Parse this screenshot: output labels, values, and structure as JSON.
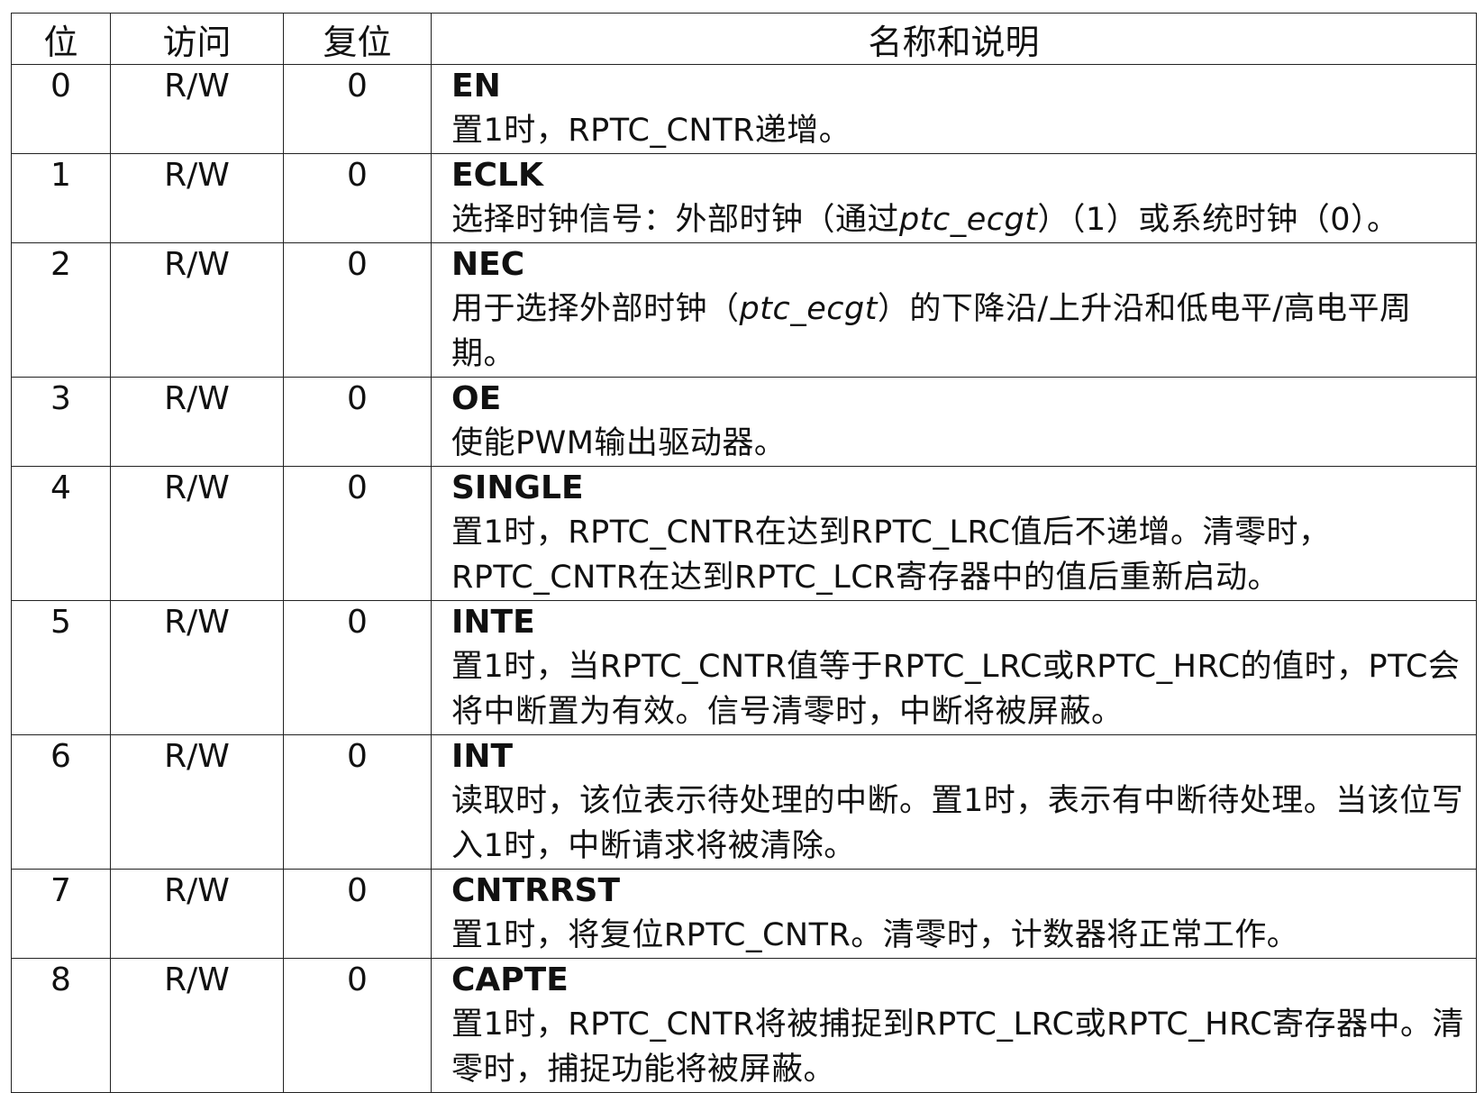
{
  "headers": {
    "bit": "位",
    "access": "访问",
    "reset": "复位",
    "description": "名称和说明"
  },
  "rows": [
    {
      "bit": "0",
      "access": "R/W",
      "reset": "0",
      "name": "EN",
      "desc": "置1时，RPTC_CNTR递增。"
    },
    {
      "bit": "1",
      "access": "R/W",
      "reset": "0",
      "name": "ECLK",
      "desc_a": "选择时钟信号：外部时钟（通过",
      "desc_em": "ptc_ecgt",
      "desc_b": "）（1）或系统时钟（0）。"
    },
    {
      "bit": "2",
      "access": "R/W",
      "reset": "0",
      "name": "NEC",
      "desc_a": "用于选择外部时钟（",
      "desc_em": "ptc_ecgt",
      "desc_b": "）的下降沿/上升沿和低电平/高电平周期。"
    },
    {
      "bit": "3",
      "access": "R/W",
      "reset": "0",
      "name": "OE",
      "desc": "使能PWM输出驱动器。"
    },
    {
      "bit": "4",
      "access": "R/W",
      "reset": "0",
      "name": "SINGLE",
      "desc": "置1时，RPTC_CNTR在达到RPTC_LRC值后不递增。清零时，RPTC_CNTR在达到RPTC_LCR寄存器中的值后重新启动。"
    },
    {
      "bit": "5",
      "access": "R/W",
      "reset": "0",
      "name": "INTE",
      "desc": "置1时，当RPTC_CNTR值等于RPTC_LRC或RPTC_HRC的值时，PTC会将中断置为有效。信号清零时，中断将被屏蔽。"
    },
    {
      "bit": "6",
      "access": "R/W",
      "reset": "0",
      "name": "INT",
      "desc": "读取时，该位表示待处理的中断。置1时，表示有中断待处理。当该位写入1时，中断请求将被清除。"
    },
    {
      "bit": "7",
      "access": "R/W",
      "reset": "0",
      "name": "CNTRRST",
      "desc": "置1时，将复位RPTC_CNTR。清零时，计数器将正常工作。"
    },
    {
      "bit": "8",
      "access": "R/W",
      "reset": "0",
      "name": "CAPTE",
      "desc": "置1时，RPTC_CNTR将被捕捉到RPTC_LRC或RPTC_HRC寄存器中。清零时，捕捉功能将被屏蔽。"
    }
  ]
}
